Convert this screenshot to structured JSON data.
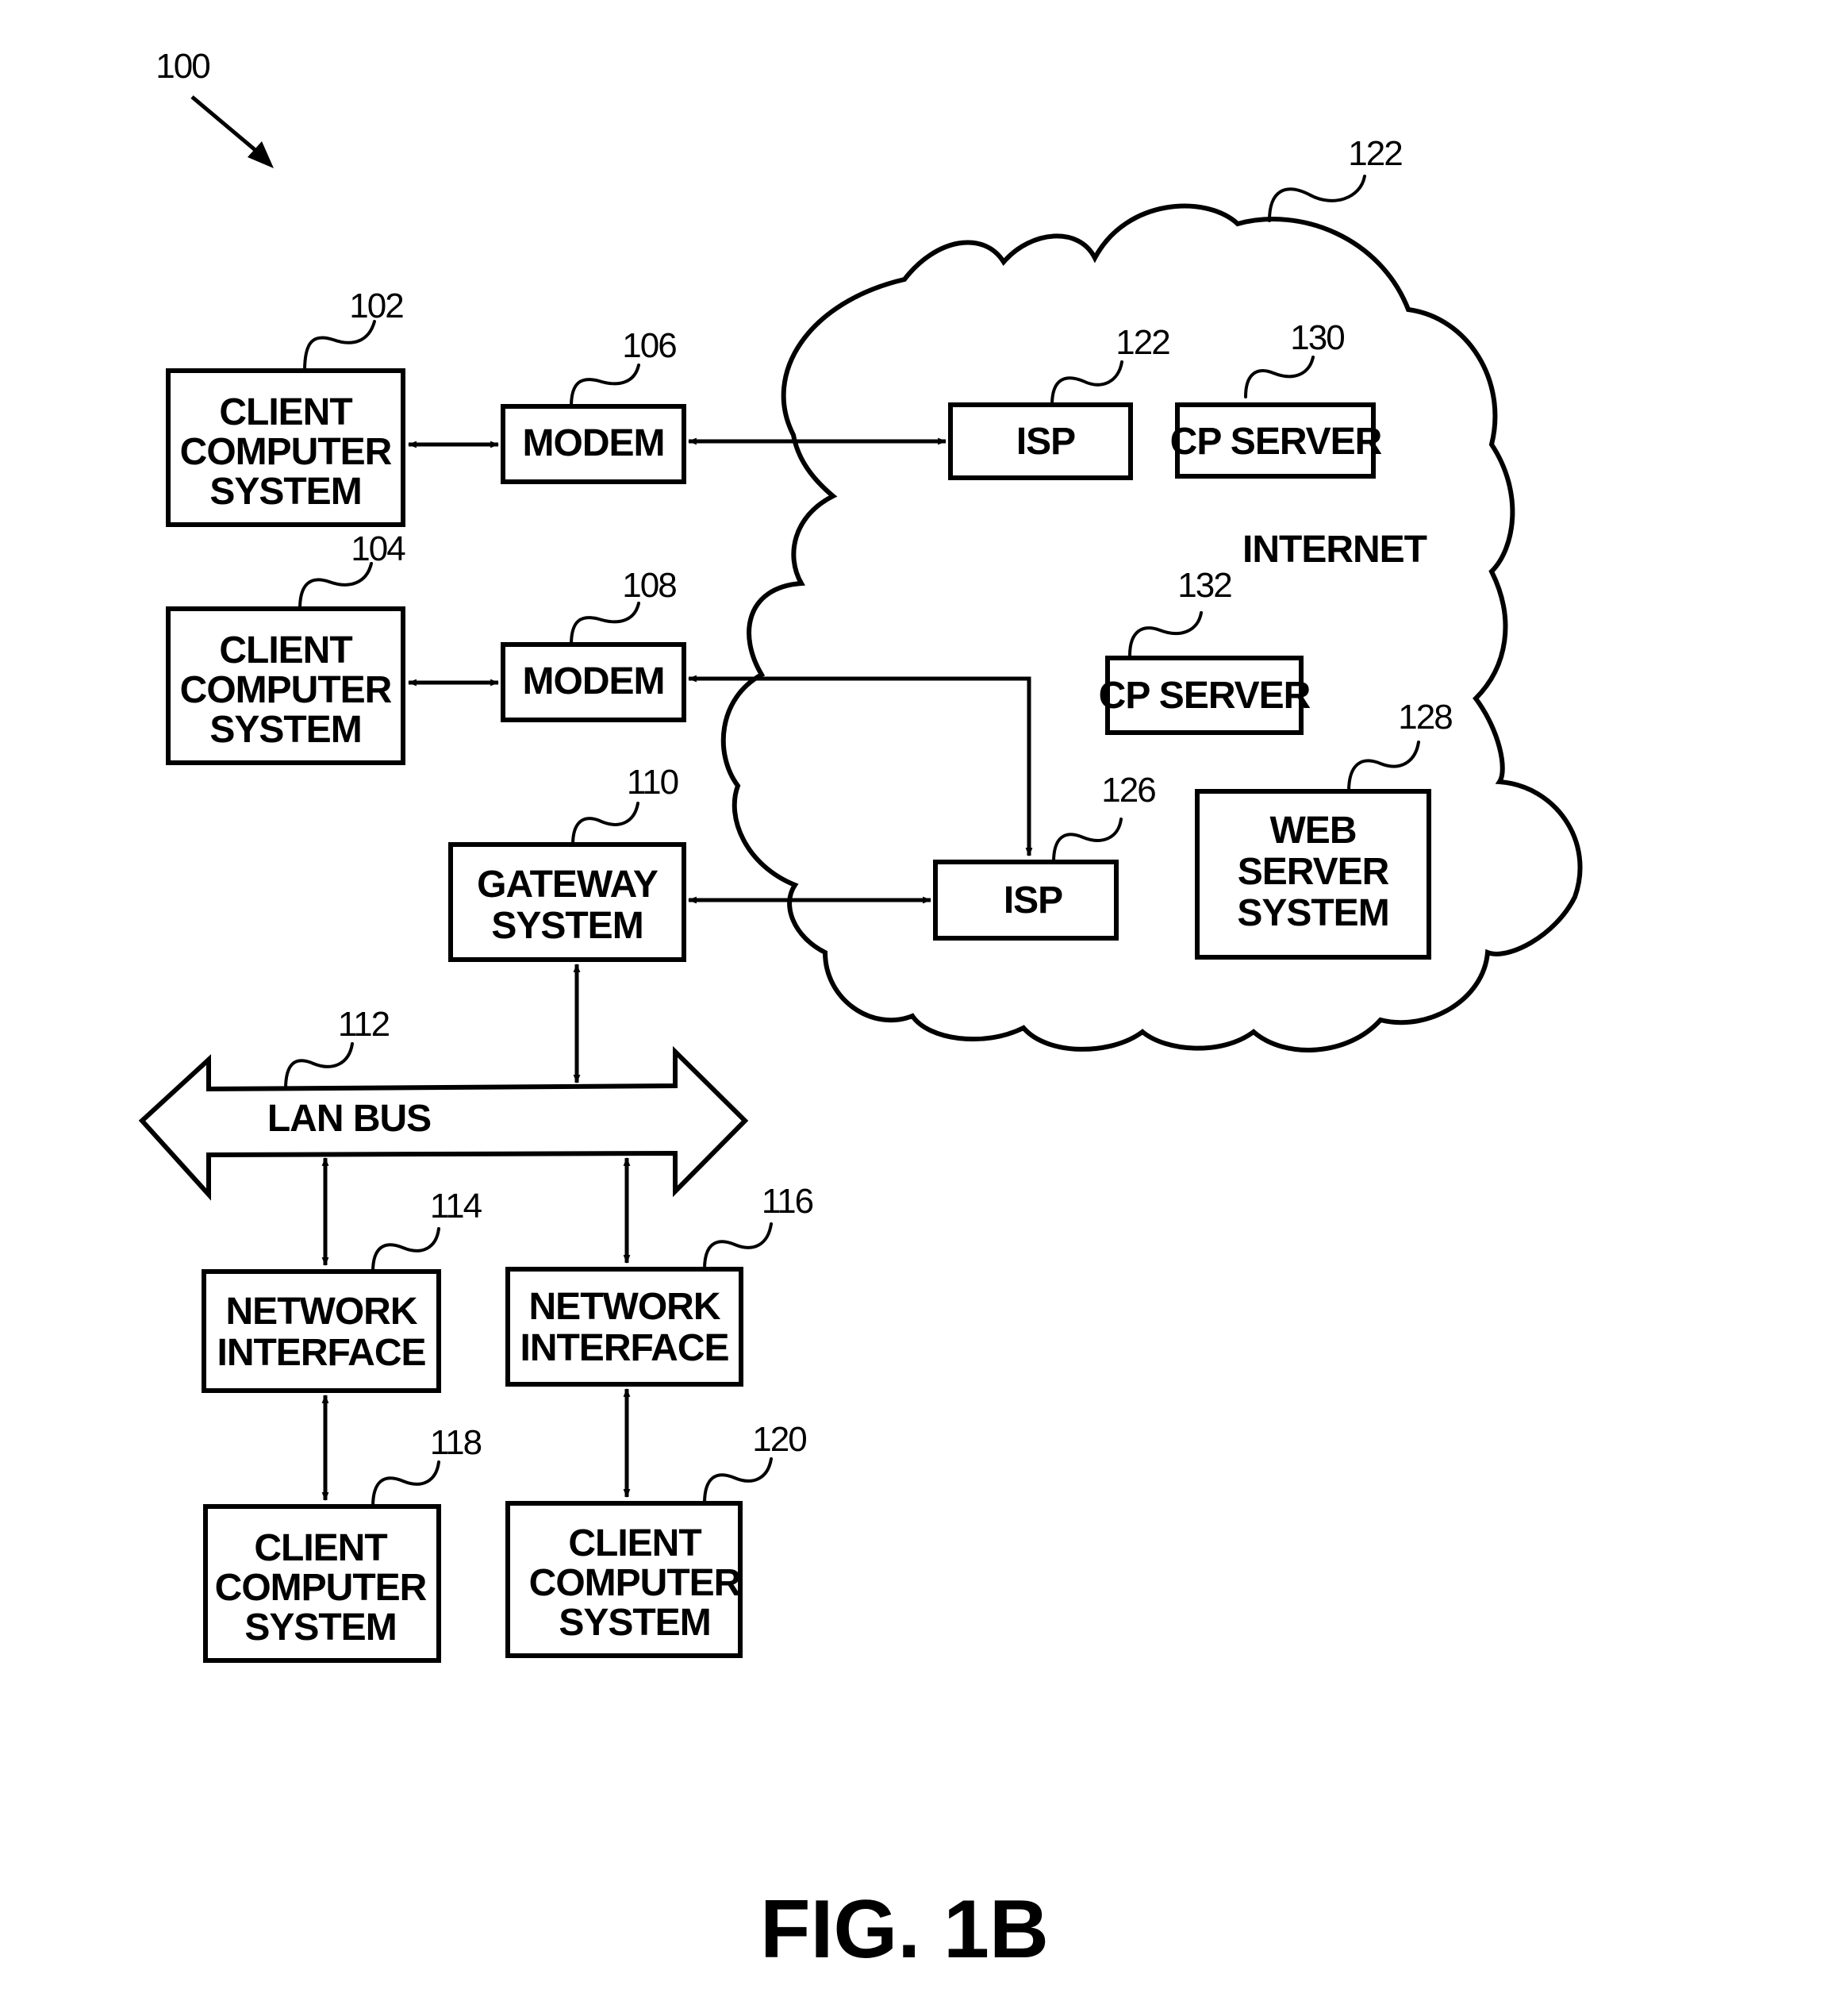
{
  "figure": {
    "title": "FIG. 1B",
    "system_ref": "100"
  },
  "nodes": {
    "client_102": {
      "ref": "102",
      "lines": [
        "CLIENT",
        "COMPUTER",
        "SYSTEM"
      ]
    },
    "client_104": {
      "ref": "104",
      "lines": [
        "CLIENT",
        "COMPUTER",
        "SYSTEM"
      ]
    },
    "modem_106": {
      "ref": "106",
      "lines": [
        "MODEM"
      ]
    },
    "modem_108": {
      "ref": "108",
      "lines": [
        "MODEM"
      ]
    },
    "gateway_110": {
      "ref": "110",
      "lines": [
        "GATEWAY",
        "SYSTEM"
      ]
    },
    "lan_bus_112": {
      "ref": "112",
      "lines": [
        "LAN BUS"
      ]
    },
    "netif_114": {
      "ref": "114",
      "lines": [
        "NETWORK",
        "INTERFACE"
      ]
    },
    "netif_116": {
      "ref": "116",
      "lines": [
        "NETWORK",
        "INTERFACE"
      ]
    },
    "client_118": {
      "ref": "118",
      "lines": [
        "CLIENT",
        "COMPUTER",
        "SYSTEM"
      ]
    },
    "client_120": {
      "ref": "120",
      "lines": [
        "CLIENT",
        "COMPUTER",
        "SYSTEM"
      ]
    },
    "internet_cloud": {
      "ref": "122",
      "lines": [
        "INTERNET"
      ]
    },
    "isp_top": {
      "ref": "122",
      "lines": [
        "ISP"
      ]
    },
    "isp_126": {
      "ref": "126",
      "lines": [
        "ISP"
      ]
    },
    "web_server_128": {
      "ref": "128",
      "lines": [
        "WEB",
        "SERVER",
        "SYSTEM"
      ]
    },
    "cp_server_130": {
      "ref": "130",
      "lines": [
        "CP SERVER"
      ]
    },
    "cp_server_132": {
      "ref": "132",
      "lines": [
        "CP SERVER"
      ]
    }
  },
  "connections": [
    {
      "from": "client_102",
      "to": "modem_106",
      "type": "bidirectional"
    },
    {
      "from": "modem_106",
      "to": "isp_top",
      "type": "bidirectional"
    },
    {
      "from": "client_104",
      "to": "modem_108",
      "type": "bidirectional"
    },
    {
      "from": "modem_108",
      "to": "isp_126",
      "type": "bidirectional"
    },
    {
      "from": "gateway_110",
      "to": "isp_126",
      "type": "bidirectional"
    },
    {
      "from": "gateway_110",
      "to": "lan_bus_112",
      "type": "bidirectional"
    },
    {
      "from": "lan_bus_112",
      "to": "netif_114",
      "type": "bidirectional"
    },
    {
      "from": "lan_bus_112",
      "to": "netif_116",
      "type": "bidirectional"
    },
    {
      "from": "netif_114",
      "to": "client_118",
      "type": "bidirectional"
    },
    {
      "from": "netif_116",
      "to": "client_120",
      "type": "bidirectional"
    }
  ]
}
